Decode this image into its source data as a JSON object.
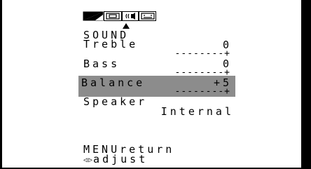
{
  "tabs": [
    {
      "name": "picture",
      "icon": "picture-contrast-icon"
    },
    {
      "name": "screen",
      "icon": "screen-icon"
    },
    {
      "name": "sound",
      "icon": "speaker-icon",
      "active": true
    },
    {
      "name": "setup",
      "icon": "setup-icon"
    }
  ],
  "menu": {
    "title": "SOUND",
    "items": [
      {
        "label": "Treble",
        "value": "0",
        "scale": "--------+"
      },
      {
        "label": "Bass",
        "value": "0",
        "scale": "--------+"
      },
      {
        "label": "Balance",
        "value": "+5",
        "scale": "--------+",
        "selected": true
      },
      {
        "label": "Speaker",
        "value": "Internal"
      }
    ]
  },
  "footer": {
    "line1": "MENUreturn",
    "line2_glyphs": "◁▷",
    "line2_text": "adjust"
  },
  "colors": {
    "background": "#ffffff",
    "border": "#000000",
    "highlight": "#8c8c8c"
  }
}
